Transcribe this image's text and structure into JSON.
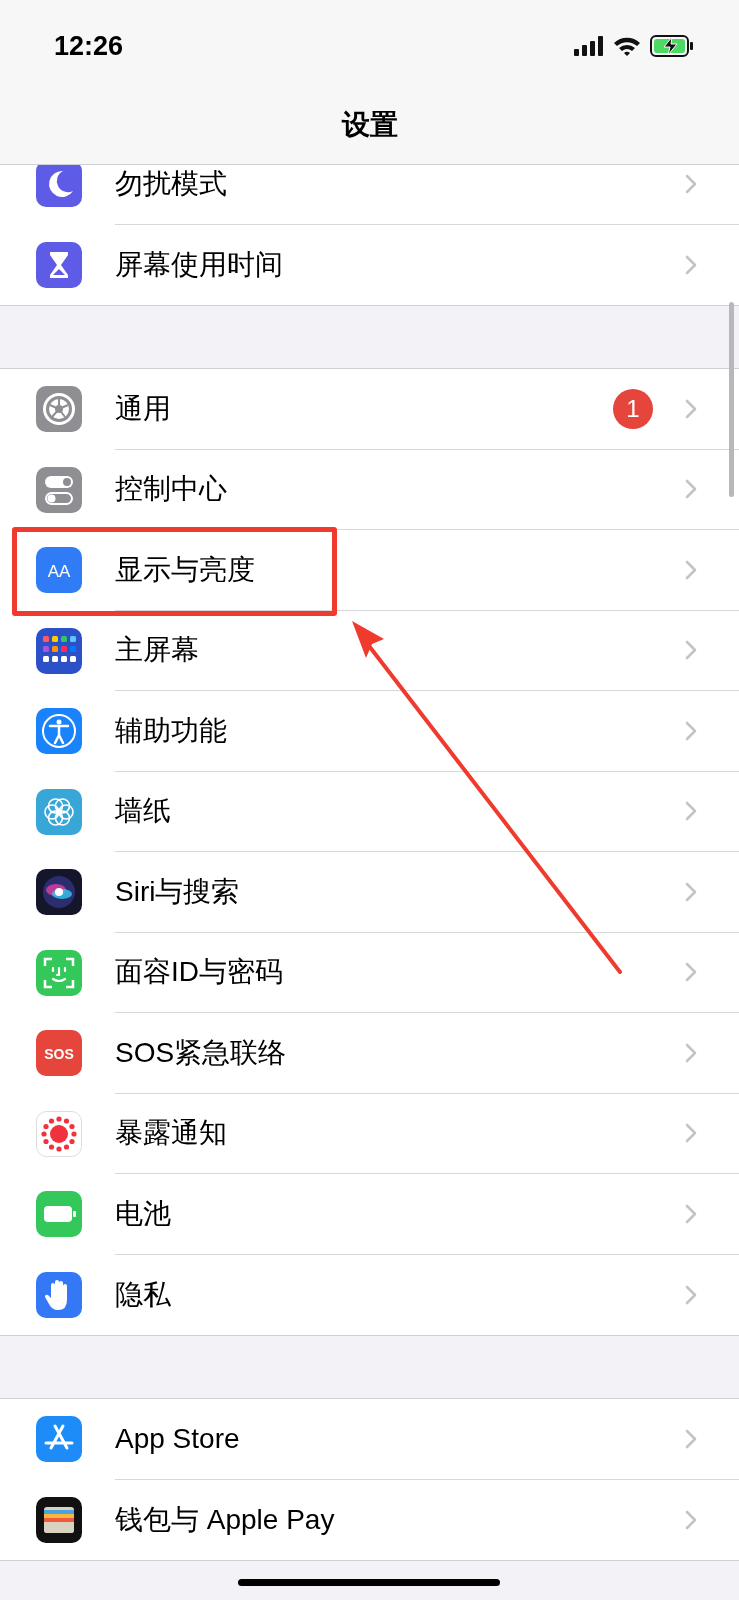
{
  "status_bar": {
    "time": "12:26"
  },
  "nav": {
    "title": "设置"
  },
  "sections": [
    {
      "rows": [
        {
          "label": "勿扰模式",
          "kind": "moon",
          "highlighted": false
        },
        {
          "label": "屏幕使用时间",
          "kind": "hourglass",
          "highlighted": false
        }
      ]
    },
    {
      "rows": [
        {
          "label": "通用",
          "kind": "gear",
          "badge": "1",
          "highlighted": false
        },
        {
          "label": "控制中心",
          "kind": "toggles",
          "highlighted": false
        },
        {
          "label": "显示与亮度",
          "kind": "text-size",
          "icon_text": "AA",
          "highlighted": true
        },
        {
          "label": "主屏幕",
          "kind": "app-grid",
          "highlighted": false
        },
        {
          "label": "辅助功能",
          "kind": "accessibility",
          "highlighted": false
        },
        {
          "label": "墙纸",
          "kind": "flower",
          "highlighted": false
        },
        {
          "label": "Siri与搜索",
          "kind": "siri",
          "highlighted": false
        },
        {
          "label": "面容ID与密码",
          "kind": "face",
          "highlighted": false
        },
        {
          "label": "SOS紧急联络",
          "kind": "sos",
          "icon_text": "SOS",
          "highlighted": false
        },
        {
          "label": "暴露通知",
          "kind": "dots-ring",
          "highlighted": false
        },
        {
          "label": "电池",
          "kind": "battery",
          "highlighted": false
        },
        {
          "label": "隐私",
          "kind": "hand",
          "highlighted": false
        }
      ]
    },
    {
      "rows": [
        {
          "label": "App Store",
          "kind": "app-store",
          "highlighted": false
        },
        {
          "label": "钱包与 Apple Pay",
          "kind": "wallet",
          "highlighted": false
        }
      ]
    }
  ]
}
